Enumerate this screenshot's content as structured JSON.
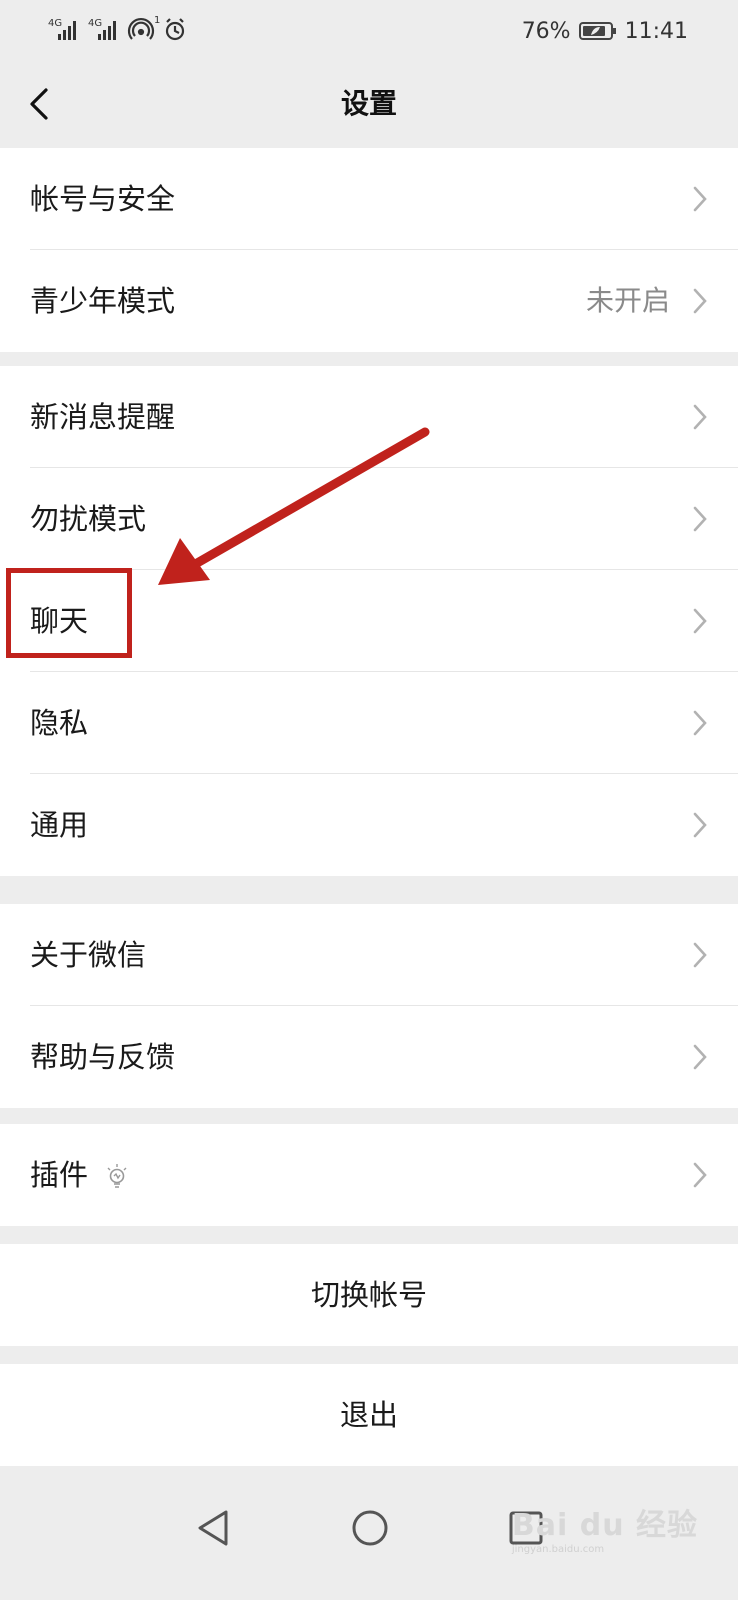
{
  "status_bar": {
    "signal1": "4G",
    "signal2": "4G",
    "hotspot_badge": "1",
    "battery_percent": "76%",
    "time": "11:41"
  },
  "nav": {
    "title": "设置"
  },
  "groups": [
    {
      "items": [
        {
          "label": "帐号与安全",
          "value": ""
        },
        {
          "label": "青少年模式",
          "value": "未开启"
        }
      ]
    },
    {
      "items": [
        {
          "label": "新消息提醒",
          "value": ""
        },
        {
          "label": "勿扰模式",
          "value": ""
        },
        {
          "label": "聊天",
          "value": ""
        },
        {
          "label": "隐私",
          "value": ""
        },
        {
          "label": "通用",
          "value": ""
        }
      ]
    },
    {
      "items": [
        {
          "label": "关于微信",
          "value": ""
        },
        {
          "label": "帮助与反馈",
          "value": ""
        }
      ]
    },
    {
      "items": [
        {
          "label": "插件",
          "value": ""
        }
      ]
    }
  ],
  "actions": {
    "switch_account": "切换帐号",
    "logout": "退出"
  },
  "watermark": {
    "brand": "Bai du 经验",
    "url": "jingyan.baidu.com"
  },
  "colors": {
    "annotation": "#c0221c",
    "background": "#ededed"
  }
}
